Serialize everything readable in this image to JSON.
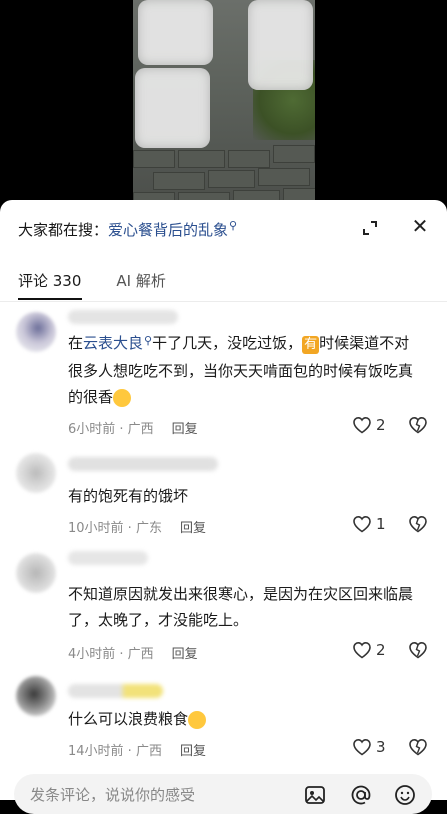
{
  "search": {
    "prefix": "大家都在搜：",
    "query": "爱心餐背后的乱象",
    "icon": "search-icon"
  },
  "tabs": [
    {
      "label": "评论 330",
      "active": true
    },
    {
      "label": "AI 解析",
      "active": false
    }
  ],
  "comments": [
    {
      "segments": [
        "在",
        "云表大良",
        "干了几天，没吃过饭，",
        "有",
        "时候渠道不对很多人想吃吃不到，当你天天啃面包的时候有饭吃真的很香"
      ],
      "meta_time": "6小时前 · 广西",
      "reply": "回复",
      "likes": "2"
    },
    {
      "segments": [
        "有的饱死有的饿坏"
      ],
      "meta_time": "10小时前 · 广东",
      "reply": "回复",
      "likes": "1"
    },
    {
      "segments": [
        "不知道原因就发出来很寒心，是因为在灾区回来临晨了，太晚了，才没能吃上。"
      ],
      "meta_time": "4小时前 · 广西",
      "reply": "回复",
      "likes": "2"
    },
    {
      "segments": [
        "什么可以浪费粮食"
      ],
      "meta_time": "14小时前 · 广西",
      "reply": "回复",
      "likes": "3"
    }
  ],
  "input": {
    "placeholder": "发条评论，说说你的感受"
  },
  "colors": {
    "link": "#2b4f8f",
    "badge": "#f2a623"
  }
}
